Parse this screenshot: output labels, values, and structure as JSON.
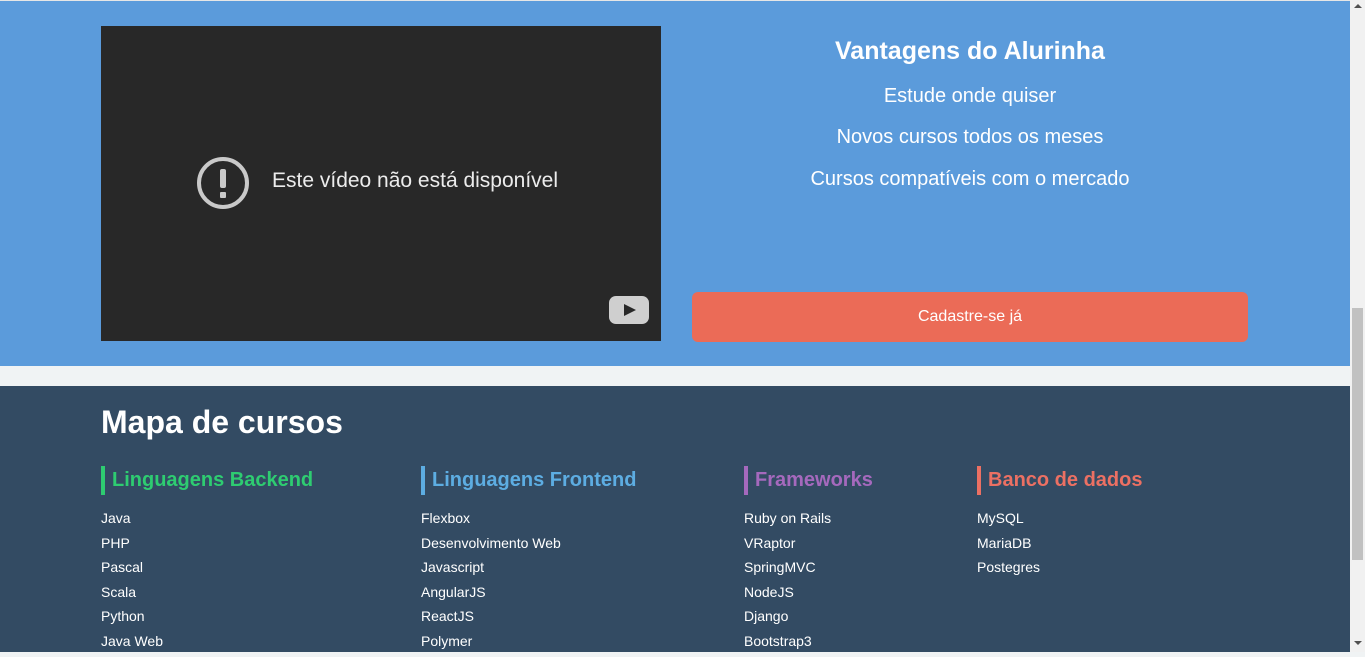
{
  "hero": {
    "video_message": "Este vídeo não está disponível",
    "advantages_title": "Vantagens do Alurinha",
    "advantages": [
      "Estude onde quiser",
      "Novos cursos todos os meses",
      "Cursos compatíveis com o mercado"
    ],
    "cta_label": "Cadastre-se já"
  },
  "footer": {
    "title": "Mapa de cursos",
    "columns": [
      {
        "heading": "Linguagens Backend",
        "color": "#2ecc71",
        "items": [
          "Java",
          "PHP",
          "Pascal",
          "Scala",
          "Python",
          "Java Web"
        ]
      },
      {
        "heading": "Linguagens Frontend",
        "color": "#5dade2",
        "items": [
          "Flexbox",
          "Desenvolvimento Web",
          "Javascript",
          "AngularJS",
          "ReactJS",
          "Polymer"
        ]
      },
      {
        "heading": "Frameworks",
        "color": "#a569bd",
        "items": [
          "Ruby on Rails",
          "VRaptor",
          "SpringMVC",
          "NodeJS",
          "Django",
          "Bootstrap3"
        ]
      },
      {
        "heading": "Banco de dados",
        "color": "#ec7063",
        "items": [
          "MySQL",
          "MariaDB",
          "Postegres"
        ]
      }
    ]
  },
  "colors": {
    "hero_bg": "#5b9bdb",
    "footer_bg": "#334b63",
    "cta_bg": "#eb6b57"
  },
  "icons": [
    "warning-circle-icon",
    "youtube-logo-icon",
    "scroll-up-arrow-icon",
    "scroll-down-arrow-icon"
  ]
}
